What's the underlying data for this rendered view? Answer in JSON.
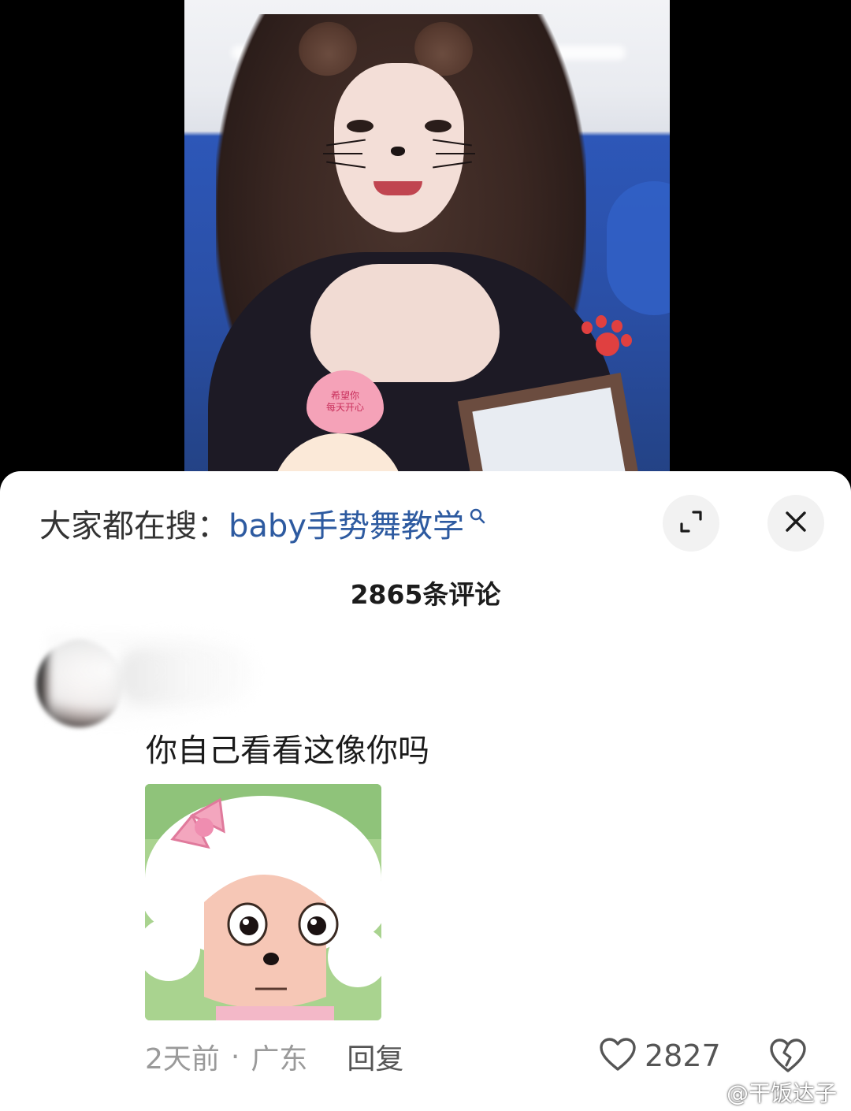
{
  "video": {
    "sticker_text_line1": "希望你",
    "sticker_text_line2": "每天开心"
  },
  "sheet": {
    "search_prefix": "大家都在搜：",
    "search_term": "baby手势舞教学",
    "comment_count": "2865条评论"
  },
  "comment": {
    "text": "你自己看看这像你吗",
    "time": "2天前",
    "separator": "·",
    "location": "广东",
    "reply_label": "回复",
    "like_count": "2827"
  },
  "watermark": {
    "text": "@干饭达子"
  },
  "icons": {
    "search": "search-icon",
    "expand": "expand-icon",
    "close": "close-icon",
    "like": "heart-outline-icon",
    "dislike": "broken-heart-icon",
    "watermark": "weibo-logo-icon"
  }
}
